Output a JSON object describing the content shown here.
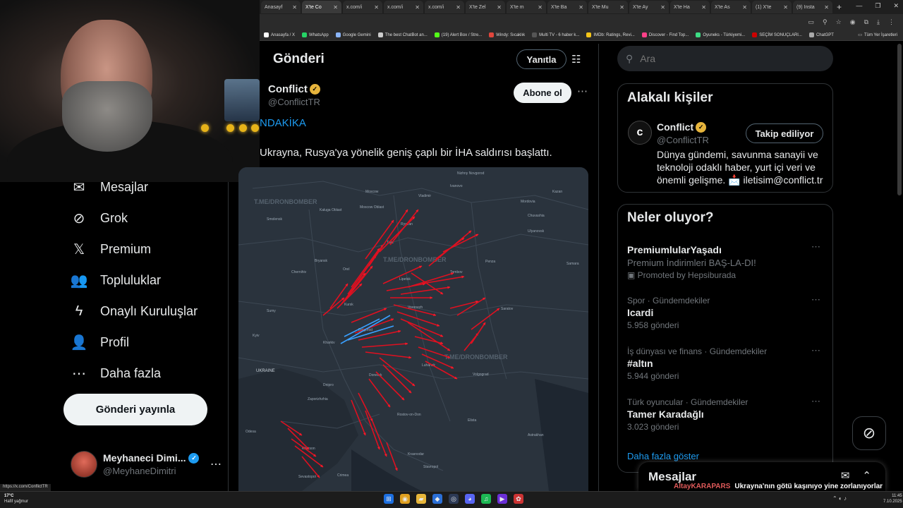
{
  "browser": {
    "tabs": [
      {
        "label": "Anasayf",
        "active": false
      },
      {
        "label": "X'te Co",
        "active": true
      },
      {
        "label": "x.com/i",
        "active": false
      },
      {
        "label": "x.com/i",
        "active": false
      },
      {
        "label": "x.com/i",
        "active": false
      },
      {
        "label": "X'te Zel",
        "active": false
      },
      {
        "label": "X'te m",
        "active": false
      },
      {
        "label": "X'te Ba",
        "active": false
      },
      {
        "label": "X'te Mu",
        "active": false
      },
      {
        "label": "X'te Ay",
        "active": false
      },
      {
        "label": "X'te Ha",
        "active": false
      },
      {
        "label": "X'te As",
        "active": false
      },
      {
        "label": "(1) X'te",
        "active": false
      },
      {
        "label": "(9) Insta",
        "active": false
      }
    ],
    "new_tab": "+",
    "bookmarks": [
      {
        "label": "Anasayfa / X",
        "color": "#ffffff"
      },
      {
        "label": "WhatsApp",
        "color": "#25d366"
      },
      {
        "label": "Google Gemini",
        "color": "#8ab4f8"
      },
      {
        "label": "The best ChatBot an...",
        "color": "#cccccc"
      },
      {
        "label": "(19) Alert Box / Stre...",
        "color": "#53fc18"
      },
      {
        "label": "Windy: Sıcaklık",
        "color": "#e0463c"
      },
      {
        "label": "Multi TV - 6 haber k...",
        "color": "#555555"
      },
      {
        "label": "IMDb: Ratings, Revi...",
        "color": "#f5c518"
      },
      {
        "label": "Discover - Find Top...",
        "color": "#ff4088"
      },
      {
        "label": "Oyuneks - Türkiyemi...",
        "color": "#3ddc84"
      },
      {
        "label": "SEÇİM SONUÇLARI...",
        "color": "#cc0000"
      },
      {
        "label": "ChatGPT",
        "color": "#aaaaaa"
      }
    ],
    "bookmarks_all": "Tüm Yer İşaretleri",
    "status_url": "https://x.com/ConflictTR"
  },
  "sidebar": {
    "items": [
      {
        "label": "Mesajlar",
        "icon": "envelope-icon",
        "glyph": "✉"
      },
      {
        "label": "Grok",
        "icon": "grok-icon",
        "glyph": "⊘"
      },
      {
        "label": "Premium",
        "icon": "x-logo-icon",
        "glyph": "𝕏"
      },
      {
        "label": "Topluluklar",
        "icon": "people-icon",
        "glyph": "👥"
      },
      {
        "label": "Onaylı Kuruluşlar",
        "icon": "lightning-icon",
        "glyph": "ϟ"
      },
      {
        "label": "Profil",
        "icon": "person-icon",
        "glyph": "👤"
      },
      {
        "label": "Daha fazla",
        "icon": "more-circle-icon",
        "glyph": "⋯"
      }
    ],
    "post_button": "Gönderi yayınla",
    "account": {
      "name": "Meyhaneci Dimi...",
      "handle": "@MeyhaneDimitri",
      "more": "⋯"
    }
  },
  "main": {
    "title": "Gönderi",
    "reply_button": "Yanıtla",
    "author": {
      "name": "Conflict",
      "handle": "@ConflictTR"
    },
    "subscribe_button": "Abone ol",
    "more": "⋯",
    "breaking": "NDAKİKA",
    "text": "Ukrayna, Rusya'ya yönelik geniş çaplı bir İHA saldırısı başlattı."
  },
  "map": {
    "watermark": "T.ME/DRONBOMBER",
    "labels": [
      "Nizhny Novgorod",
      "Moscow",
      "Moscow Oblast",
      "Vladimir",
      "Ivanovo",
      "Ryazan",
      "Kaluga Oblast",
      "Tula",
      "Smolensk",
      "Bryansk",
      "Orel",
      "Kursk",
      "Belgorod",
      "Kharkiv",
      "Voronezh",
      "Lipetsk",
      "Tambov",
      "Penza",
      "Saratov",
      "Ulyanovsk",
      "Kazan",
      "Samara",
      "Dnipro",
      "Donetsk",
      "Luhansk",
      "Zaporizhzhia",
      "Rostov-on-Don",
      "Volgograd",
      "Kherson",
      "Crimea",
      "Odesa",
      "Sevastopol",
      "Krasnodar",
      "Stavropol",
      "Elista",
      "Astrakhan",
      "UKRAINE",
      "Kyiv",
      "Sumy",
      "Mordovia",
      "Chuvashia",
      "Chernihiv"
    ]
  },
  "right": {
    "search_placeholder": "Ara",
    "who": {
      "title": "Alakalı kişiler",
      "name": "Conflict",
      "handle": "@ConflictTR",
      "follow_button": "Takip ediliyor",
      "bio": "Dünya gündemi, savunma sanayii ve teknoloji odaklı haber, yurt içi veri ve önemli gelişme. 📩 iletisim@conflict.tr"
    },
    "trends_title": "Neler oluyor?",
    "promo": {
      "name": "PremiumlularYaşadı",
      "sub": "Premium İndirimleri BAŞ-LA-DI!",
      "promoted": "Promoted by Hepsiburada"
    },
    "trends": [
      {
        "meta": "Spor · Gündemdekiler",
        "name": "Icardi",
        "count": "5.958 gönderi"
      },
      {
        "meta": "İş dünyası ve finans · Gündemdekiler",
        "name": "#altın",
        "count": "5.944 gönderi"
      },
      {
        "meta": "Türk oyuncular · Gündemdekiler",
        "name": "Tamer Karadağlı",
        "count": "3.023 gönderi"
      }
    ],
    "show_more": "Daha fazla göster",
    "messages": "Mesajlar"
  },
  "chat": {
    "user": "AltayKARAPARS",
    "message": "Ukrayna'nın götü kaşınıyo yine zorlanıyorlar soykırıma uğrat bizi Putin baba diye..."
  },
  "taskbar": {
    "temp": "17°C",
    "weather": "Hafif yağmur",
    "time": "11:45",
    "date": "7.10.2025"
  }
}
